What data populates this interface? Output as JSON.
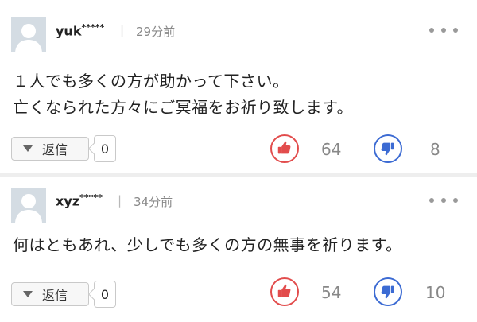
{
  "comments": [
    {
      "username": "yuk",
      "username_mask": "*****",
      "separator": "|",
      "time": "29分前",
      "text_lines": [
        "１人でも多くの方が助かって下さい。",
        "亡くなられた方々にご冥福をお祈り致します。"
      ],
      "reply_label": "返信",
      "reply_count": "0",
      "like_count": "64",
      "dislike_count": "8"
    },
    {
      "username": "xyz",
      "username_mask": "*****",
      "separator": "|",
      "time": "34分前",
      "text_lines": [
        "何はともあれ、少しでも多くの方の無事を祈ります。"
      ],
      "reply_label": "返信",
      "reply_count": "0",
      "like_count": "54",
      "dislike_count": "10"
    }
  ],
  "icons": {
    "avatar": "default-user-avatar",
    "more": "more-horizontal-icon",
    "reply": "triangle-down-icon",
    "like": "thumbs-up-icon",
    "dislike": "thumbs-down-icon"
  },
  "colors": {
    "like": "#e24c4c",
    "dislike": "#3c6bd3",
    "muted_text": "#888888",
    "divider": "#eeeeee"
  }
}
